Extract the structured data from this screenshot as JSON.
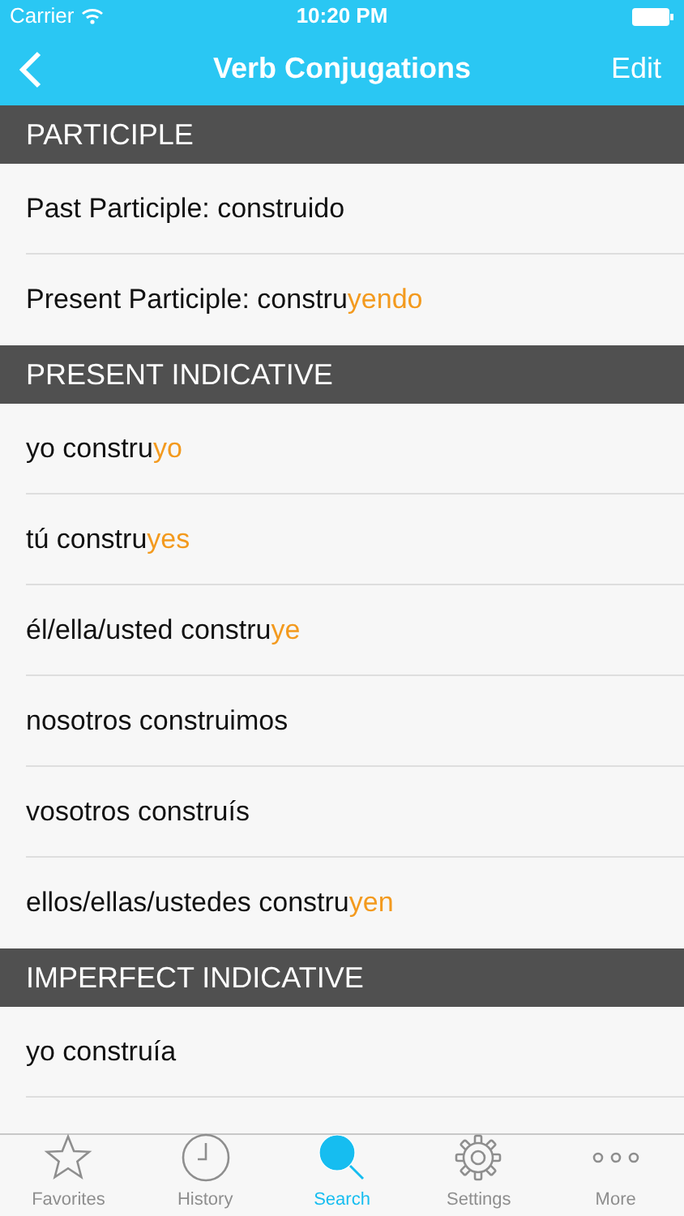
{
  "status_bar": {
    "carrier": "Carrier",
    "time": "10:20 PM"
  },
  "nav_bar": {
    "title": "Verb Conjugations",
    "action": "Edit"
  },
  "sections": [
    {
      "title": "PARTICIPLE",
      "rows": [
        {
          "stem": "Past Participle: construido",
          "ending": ""
        },
        {
          "stem": "Present Participle: constru",
          "ending": "yendo"
        }
      ]
    },
    {
      "title": "PRESENT INDICATIVE",
      "rows": [
        {
          "stem": "yo constru",
          "ending": "yo"
        },
        {
          "stem": "tú constru",
          "ending": "yes"
        },
        {
          "stem": "él/ella/usted constru",
          "ending": "ye"
        },
        {
          "stem": "nosotros construimos",
          "ending": ""
        },
        {
          "stem": "vosotros construís",
          "ending": ""
        },
        {
          "stem": "ellos/ellas/ustedes constru",
          "ending": "yen"
        }
      ]
    },
    {
      "title": "IMPERFECT INDICATIVE",
      "rows": [
        {
          "stem": "yo construía",
          "ending": ""
        }
      ]
    }
  ],
  "tab_bar": [
    {
      "label": "Favorites",
      "kind": "star",
      "selected": false
    },
    {
      "label": "History",
      "kind": "clock",
      "selected": false
    },
    {
      "label": "Search",
      "kind": "search",
      "selected": true
    },
    {
      "label": "Settings",
      "kind": "gear",
      "selected": false
    },
    {
      "label": "More",
      "kind": "more",
      "selected": false
    }
  ]
}
